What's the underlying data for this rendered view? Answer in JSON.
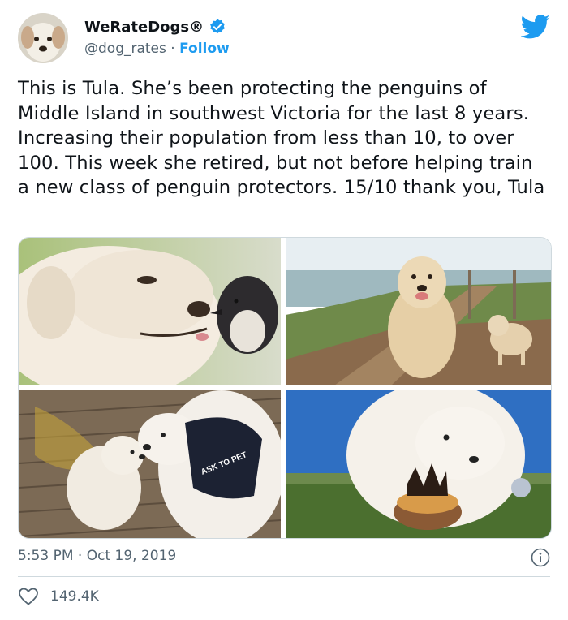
{
  "user": {
    "display_name": "WeRateDogs®",
    "handle": "@dog_rates",
    "separator": "·",
    "follow_label": "Follow",
    "verified_icon": "verified-badge-icon",
    "platform_icon": "twitter-bird-icon"
  },
  "tweet": {
    "text": "This is Tula. She’s been protecting the penguins of Middle Island in southwest Victoria for the last 8 years. Increasing their population from less than 10, to over 100. This week she retired, but not before helping train a new class of penguin protectors. 15/10 thank you, Tula",
    "harness_text": "ASK TO PET"
  },
  "meta": {
    "time": "5:53 PM",
    "separator": "·",
    "date": "Oct 19, 2019",
    "info_icon": "info-icon"
  },
  "engagement": {
    "like_icon": "heart-icon",
    "likes": "149.4K"
  },
  "colors": {
    "accent": "#1d9bf0",
    "text": "#0f1419",
    "secondary": "#536471",
    "border": "#cfd9de"
  }
}
